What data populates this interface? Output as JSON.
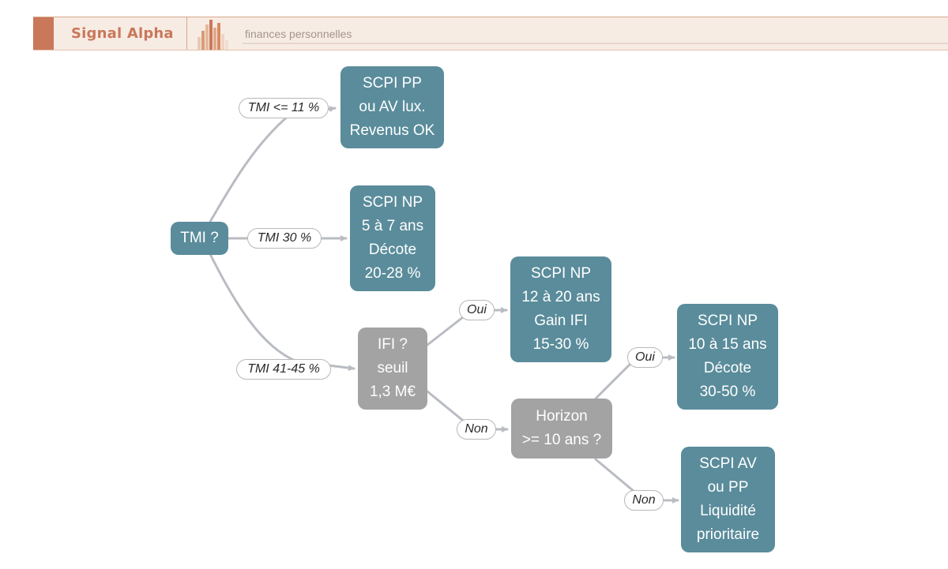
{
  "header": {
    "brand": "Signal Alpha",
    "subtitle": "finances personnelles",
    "accent_color": "#c9785a"
  },
  "diagram": {
    "colors": {
      "result_node": "#5a8c9b",
      "question_node": "#a3a3a3",
      "connector": "#b9bcc2"
    },
    "nodes": {
      "tmi": {
        "lines": [
          "TMI ?"
        ]
      },
      "ifi": {
        "lines": [
          "IFI ?",
          "seuil",
          "1,3 M€"
        ]
      },
      "horizon": {
        "lines": [
          "Horizon",
          ">= 10 ans ?"
        ]
      },
      "scpi_pp": {
        "lines": [
          "SCPI PP",
          "ou AV lux.",
          "Revenus OK"
        ]
      },
      "scpi_np_5_7": {
        "lines": [
          "SCPI NP",
          "5 à 7 ans",
          "Décote",
          "20-28 %"
        ]
      },
      "scpi_np_12_20": {
        "lines": [
          "SCPI NP",
          "12 à 20 ans",
          "Gain IFI",
          "15-30 %"
        ]
      },
      "scpi_np_10_15": {
        "lines": [
          "SCPI NP",
          "10 à 15 ans",
          "Décote",
          "30-50 %"
        ]
      },
      "scpi_av_pp": {
        "lines": [
          "SCPI AV",
          "ou PP",
          "Liquidité",
          "prioritaire"
        ]
      }
    },
    "edge_labels": {
      "tmi_11": "TMI <= 11 %",
      "tmi_30": "TMI 30 %",
      "tmi_41_45": "TMI 41-45 %",
      "ifi_oui": "Oui",
      "ifi_non": "Non",
      "horizon_oui": "Oui",
      "horizon_non": "Non"
    }
  }
}
